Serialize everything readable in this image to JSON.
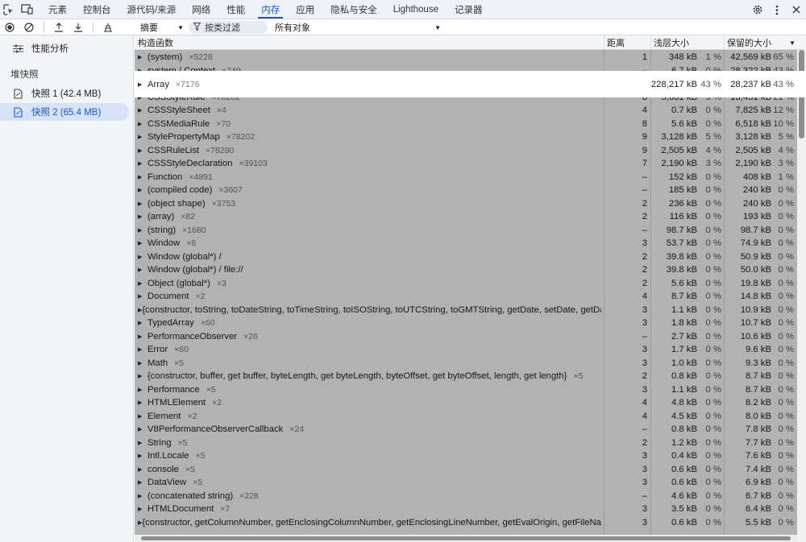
{
  "top_tabs": [
    "元素",
    "控制台",
    "源代码/来源",
    "网络",
    "性能",
    "内存",
    "应用",
    "隐私与安全",
    "Lighthouse",
    "记录器"
  ],
  "active_tab_index": 5,
  "toolbar": {
    "view_select": "摘要",
    "filter_label": "按类过滤",
    "object_select": "所有对象"
  },
  "sidebar": {
    "profiler": "性能分析",
    "section": "堆快照",
    "snapshots": [
      "快照 1 (42.4 MB)",
      "快照 2 (65.4 MB)"
    ],
    "selected_index": 1
  },
  "columns": {
    "constructor": "构造函数",
    "distance": "距离",
    "shallow": "浅层大小",
    "retained": "保留的大小"
  },
  "highlight_row_index": 2,
  "rows": [
    {
      "name": "(system)",
      "count": "×5228",
      "distance": "1",
      "shallow": "348 kB",
      "shallow_pct": "1 %",
      "retained": "42,569 kB",
      "retained_pct": "65 %"
    },
    {
      "name": "system / Context",
      "count": "×249",
      "distance": "–",
      "shallow": "6.7 kB",
      "shallow_pct": "0 %",
      "retained": "28,322 kB",
      "retained_pct": "43 %"
    },
    {
      "name": "Array",
      "count": "×7176",
      "distance": "2",
      "shallow": "28,217 kB",
      "shallow_pct": "43 %",
      "retained": "28,237 kB",
      "retained_pct": "43 %"
    },
    {
      "name": "CSSStyleRule",
      "count": "×78202",
      "distance": "8",
      "shallow": "5,631 kB",
      "shallow_pct": "9 %",
      "retained": "13,451 kB",
      "retained_pct": "21 %"
    },
    {
      "name": "CSSStyleSheet",
      "count": "×4",
      "distance": "4",
      "shallow": "0.7 kB",
      "shallow_pct": "0 %",
      "retained": "7,825 kB",
      "retained_pct": "12 %"
    },
    {
      "name": "CSSMediaRule",
      "count": "×70",
      "distance": "8",
      "shallow": "5.6 kB",
      "shallow_pct": "0 %",
      "retained": "6,518 kB",
      "retained_pct": "10 %"
    },
    {
      "name": "StylePropertyMap",
      "count": "×78202",
      "distance": "9",
      "shallow": "3,128 kB",
      "shallow_pct": "5 %",
      "retained": "3,128 kB",
      "retained_pct": "5 %"
    },
    {
      "name": "CSSRuleList",
      "count": "×78280",
      "distance": "9",
      "shallow": "2,505 kB",
      "shallow_pct": "4 %",
      "retained": "2,505 kB",
      "retained_pct": "4 %"
    },
    {
      "name": "CSSStyleDeclaration",
      "count": "×39103",
      "distance": "7",
      "shallow": "2,190 kB",
      "shallow_pct": "3 %",
      "retained": "2,190 kB",
      "retained_pct": "3 %"
    },
    {
      "name": "Function",
      "count": "×4891",
      "distance": "–",
      "shallow": "152 kB",
      "shallow_pct": "0 %",
      "retained": "408 kB",
      "retained_pct": "1 %"
    },
    {
      "name": "(compiled code)",
      "count": "×3607",
      "distance": "–",
      "shallow": "185 kB",
      "shallow_pct": "0 %",
      "retained": "240 kB",
      "retained_pct": "0 %"
    },
    {
      "name": "(object shape)",
      "count": "×3753",
      "distance": "2",
      "shallow": "236 kB",
      "shallow_pct": "0 %",
      "retained": "240 kB",
      "retained_pct": "0 %"
    },
    {
      "name": "(array)",
      "count": "×82",
      "distance": "2",
      "shallow": "116 kB",
      "shallow_pct": "0 %",
      "retained": "193 kB",
      "retained_pct": "0 %"
    },
    {
      "name": "(string)",
      "count": "×1680",
      "distance": "–",
      "shallow": "98.7 kB",
      "shallow_pct": "0 %",
      "retained": "98.7 kB",
      "retained_pct": "0 %"
    },
    {
      "name": "Window",
      "count": "×8",
      "distance": "3",
      "shallow": "53.7 kB",
      "shallow_pct": "0 %",
      "retained": "74.9 kB",
      "retained_pct": "0 %"
    },
    {
      "name": "Window (global*) /",
      "count": "",
      "distance": "2",
      "shallow": "39.8 kB",
      "shallow_pct": "0 %",
      "retained": "50.9 kB",
      "retained_pct": "0 %"
    },
    {
      "name": "Window (global*) / file://",
      "count": "",
      "distance": "2",
      "shallow": "39.8 kB",
      "shallow_pct": "0 %",
      "retained": "50.0 kB",
      "retained_pct": "0 %"
    },
    {
      "name": "Object (global*)",
      "count": "×3",
      "distance": "2",
      "shallow": "5.6 kB",
      "shallow_pct": "0 %",
      "retained": "19.8 kB",
      "retained_pct": "0 %"
    },
    {
      "name": "Document",
      "count": "×2",
      "distance": "4",
      "shallow": "8.7 kB",
      "shallow_pct": "0 %",
      "retained": "14.8 kB",
      "retained_pct": "0 %"
    },
    {
      "name": "{constructor, toString, toDateString, toTimeString, toISOString, toUTCString, toGMTString, getDate, setDate, getDay}…",
      "count": "",
      "distance": "3",
      "shallow": "1.1 kB",
      "shallow_pct": "0 %",
      "retained": "10.9 kB",
      "retained_pct": "0 %"
    },
    {
      "name": "TypedArray",
      "count": "×60",
      "distance": "3",
      "shallow": "1.8 kB",
      "shallow_pct": "0 %",
      "retained": "10.7 kB",
      "retained_pct": "0 %"
    },
    {
      "name": "PerformanceObserver",
      "count": "×26",
      "distance": "–",
      "shallow": "2.7 kB",
      "shallow_pct": "0 %",
      "retained": "10.6 kB",
      "retained_pct": "0 %"
    },
    {
      "name": "Error",
      "count": "×60",
      "distance": "3",
      "shallow": "1.7 kB",
      "shallow_pct": "0 %",
      "retained": "9.6 kB",
      "retained_pct": "0 %"
    },
    {
      "name": "Math",
      "count": "×5",
      "distance": "3",
      "shallow": "1.0 kB",
      "shallow_pct": "0 %",
      "retained": "9.3 kB",
      "retained_pct": "0 %"
    },
    {
      "name": "{constructor, buffer, get buffer, byteLength, get byteLength, byteOffset, get byteOffset, length, get length}",
      "count": "×5",
      "distance": "2",
      "shallow": "0.8 kB",
      "shallow_pct": "0 %",
      "retained": "8.7 kB",
      "retained_pct": "0 %"
    },
    {
      "name": "Performance",
      "count": "×5",
      "distance": "3",
      "shallow": "1.1 kB",
      "shallow_pct": "0 %",
      "retained": "8.7 kB",
      "retained_pct": "0 %"
    },
    {
      "name": "HTMLElement",
      "count": "×2",
      "distance": "4",
      "shallow": "4.8 kB",
      "shallow_pct": "0 %",
      "retained": "8.2 kB",
      "retained_pct": "0 %"
    },
    {
      "name": "Element",
      "count": "×2",
      "distance": "4",
      "shallow": "4.5 kB",
      "shallow_pct": "0 %",
      "retained": "8.0 kB",
      "retained_pct": "0 %"
    },
    {
      "name": "V8PerformanceObserverCallback",
      "count": "×24",
      "distance": "–",
      "shallow": "0.8 kB",
      "shallow_pct": "0 %",
      "retained": "7.8 kB",
      "retained_pct": "0 %"
    },
    {
      "name": "String",
      "count": "×5",
      "distance": "2",
      "shallow": "1.2 kB",
      "shallow_pct": "0 %",
      "retained": "7.7 kB",
      "retained_pct": "0 %"
    },
    {
      "name": "Intl.Locale",
      "count": "×5",
      "distance": "3",
      "shallow": "0.4 kB",
      "shallow_pct": "0 %",
      "retained": "7.6 kB",
      "retained_pct": "0 %"
    },
    {
      "name": "console",
      "count": "×5",
      "distance": "3",
      "shallow": "0.6 kB",
      "shallow_pct": "0 %",
      "retained": "7.4 kB",
      "retained_pct": "0 %"
    },
    {
      "name": "DataView",
      "count": "×5",
      "distance": "3",
      "shallow": "0.6 kB",
      "shallow_pct": "0 %",
      "retained": "6.9 kB",
      "retained_pct": "0 %"
    },
    {
      "name": "(concatenated string)",
      "count": "×228",
      "distance": "–",
      "shallow": "4.6 kB",
      "shallow_pct": "0 %",
      "retained": "6.7 kB",
      "retained_pct": "0 %"
    },
    {
      "name": "HTMLDocument",
      "count": "×7",
      "distance": "3",
      "shallow": "3.5 kB",
      "shallow_pct": "0 %",
      "retained": "6.4 kB",
      "retained_pct": "0 %"
    },
    {
      "name": "{constructor, getColumnNumber, getEnclosingColumnNumber, getEnclosingLineNumber, getEvalOrigin, getFileName…",
      "count": "",
      "distance": "3",
      "shallow": "0.6 kB",
      "shallow_pct": "0 %",
      "retained": "5.5 kB",
      "retained_pct": "0 %"
    }
  ]
}
